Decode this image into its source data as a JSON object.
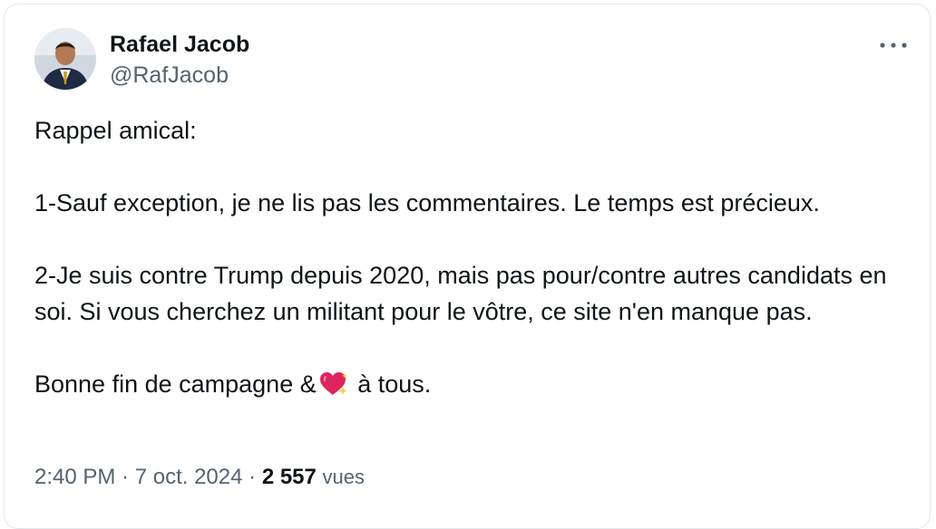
{
  "tweet": {
    "author": {
      "name": "Rafael Jacob",
      "handle": "@RafJacob"
    },
    "more_icon": "ellipsis-horizontal-icon",
    "body": {
      "line1": "Rappel amical:",
      "line2": "1-Sauf exception, je ne lis pas les commentaires. Le temps est précieux.",
      "line3": "2-Je suis contre Trump depuis 2020, mais pas pour/contre autres candidats en soi. Si vous cherchez un militant pour le vôtre, ce site n'en manque pas.",
      "line4_before": "Bonne fin de campagne &",
      "line4_emoji": "sparkling-heart-emoji",
      "line4_after": " à tous."
    },
    "meta": {
      "time": "2:40 PM",
      "sep1": " · ",
      "date": "7 oct. 2024",
      "sep2": " · ",
      "views_count": "2 557",
      "views_label": "vues"
    }
  },
  "colors": {
    "text_primary": "#0f1419",
    "text_secondary": "#536471",
    "border": "#e1e8ed",
    "heart": "#e0245e"
  }
}
